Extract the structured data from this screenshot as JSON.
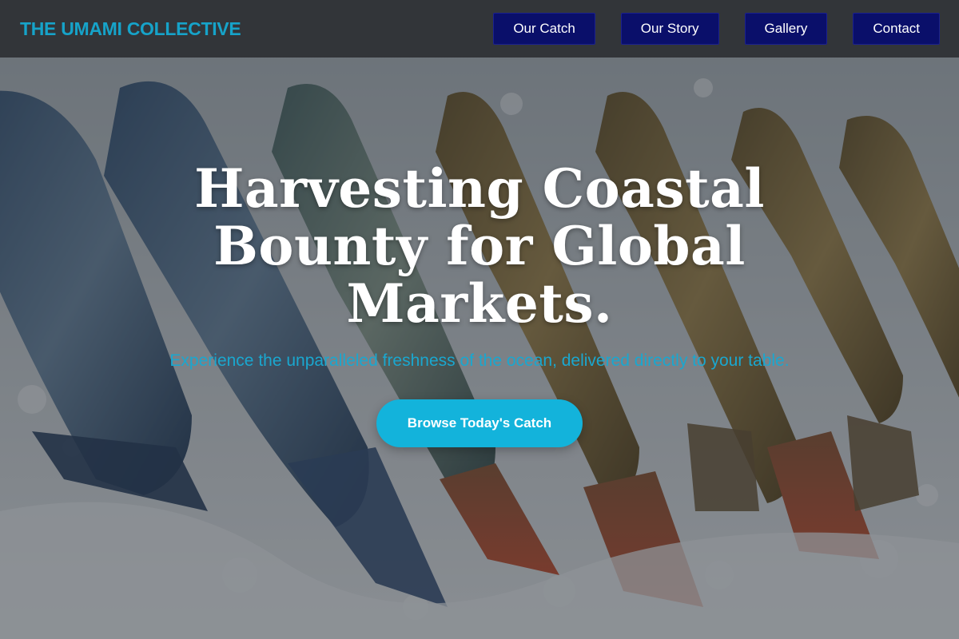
{
  "header": {
    "brand": "THE UMAMI COLLECTIVE",
    "nav": [
      {
        "label": "Our Catch"
      },
      {
        "label": "Our Story"
      },
      {
        "label": "Gallery"
      },
      {
        "label": "Contact"
      }
    ]
  },
  "hero": {
    "title": "Harvesting Coastal Bounty for Global Markets.",
    "subtitle": "Experience the unparalleled freshness of the ocean, delivered directly to your table.",
    "cta_label": "Browse Today's Catch",
    "background_image": "fish-on-ice-photo"
  },
  "colors": {
    "brand": "#16a3c9",
    "nav_button": "#0a0f6a",
    "cta": "#13b3db",
    "subtitle": "#1aa7cf"
  }
}
